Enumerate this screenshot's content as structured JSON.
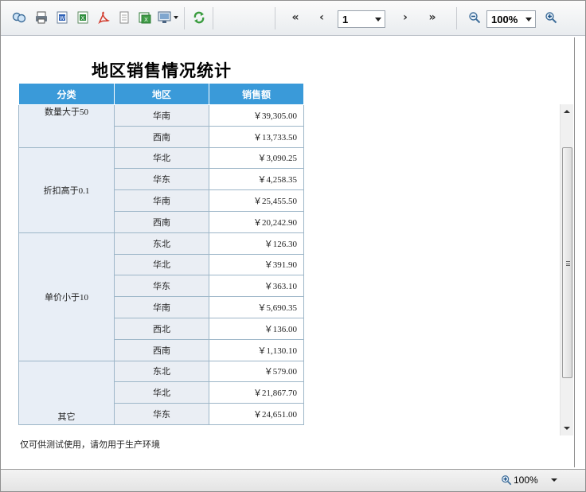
{
  "toolbar": {
    "icons": [
      "search-icon",
      "print-icon",
      "word-export-icon",
      "excel-export-icon",
      "pdf-export-icon",
      "text-export-icon",
      "image-export-icon",
      "display-mode-icon",
      "refresh-icon",
      "first-page-icon",
      "prev-page-icon",
      "next-page-icon",
      "last-page-icon",
      "zoom-out-icon",
      "zoom-in-icon"
    ],
    "first_label": "«",
    "prev_label": "‹",
    "next_label": "›",
    "last_label": "»",
    "page_value": "1",
    "zoom_value": "100%"
  },
  "report": {
    "title": "地区销售情况统计",
    "headers": [
      "分类",
      "地区",
      "销售额"
    ],
    "groups": [
      {
        "category": "数量大于50",
        "rows": [
          [
            "华南",
            "￥39,305.00"
          ],
          [
            "西南",
            "￥13,733.50"
          ]
        ]
      },
      {
        "category": "折扣高于0.1",
        "rows": [
          [
            "华北",
            "￥3,090.25"
          ],
          [
            "华东",
            "￥4,258.35"
          ],
          [
            "华南",
            "￥25,455.50"
          ],
          [
            "西南",
            "￥20,242.90"
          ]
        ]
      },
      {
        "category": "单价小于10",
        "rows": [
          [
            "东北",
            "￥126.30"
          ],
          [
            "华北",
            "￥391.90"
          ],
          [
            "华东",
            "￥363.10"
          ],
          [
            "华南",
            "￥5,690.35"
          ],
          [
            "西北",
            "￥136.00"
          ],
          [
            "西南",
            "￥1,130.10"
          ]
        ]
      },
      {
        "category": "其它",
        "rows": [
          [
            "东北",
            "￥579.00"
          ],
          [
            "华北",
            "￥21,867.70"
          ],
          [
            "华东",
            "￥24,651.00"
          ]
        ]
      }
    ],
    "note": "仅可供测试使用，请勿用于生产环境"
  },
  "statusbar": {
    "zoom": "100%"
  },
  "colors": {
    "header_bg": "#3a9ad9",
    "category_bg": "#e8eef6",
    "border": "#9db6c8"
  }
}
